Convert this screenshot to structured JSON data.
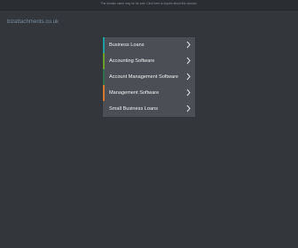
{
  "top_notice": "The domain name may be for sale. Click here to inquire about this domain.",
  "domain_name": "bizattachments.co.uk",
  "menu": {
    "items": [
      {
        "label": "Business Loans",
        "accent": "#1f9fa0",
        "icon": "chevron-right-icon"
      },
      {
        "label": "Accounting Software",
        "accent": "#6a9f2c",
        "icon": "chevron-right-icon"
      },
      {
        "label": "Account Management Software",
        "accent": "#2f6f50",
        "icon": "chevron-right-icon"
      },
      {
        "label": "Management Software",
        "accent": "#d9792b",
        "icon": "chevron-right-icon"
      },
      {
        "label": "Small Business Loans",
        "accent": "",
        "icon": "chevron-right-icon"
      }
    ]
  },
  "colors": {
    "background": "#33363b",
    "menu_background": "#4b4f55",
    "menu_text": "#f0f1f2"
  }
}
